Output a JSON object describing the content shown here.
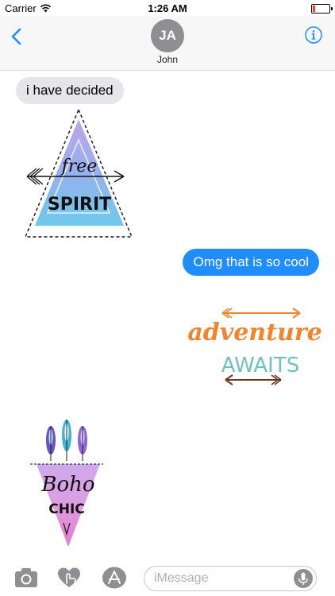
{
  "status_bar": {
    "carrier": "Carrier",
    "time": "1:26 AM"
  },
  "header": {
    "avatar_initials": "JA",
    "contact_name": "John"
  },
  "messages": [
    {
      "direction": "incoming",
      "text": "i have decided"
    },
    {
      "direction": "outgoing",
      "text": "Omg that is so cool"
    }
  ],
  "stickers": {
    "free_spirit": {
      "line1": "free",
      "line2": "SPIRIT"
    },
    "adventure": {
      "line1": "adventure",
      "line2": "AWAITS"
    },
    "boho": {
      "line1": "Boho",
      "line2": "CHIC"
    }
  },
  "input_bar": {
    "placeholder": "iMessage"
  },
  "colors": {
    "accent": "#1f8dfb",
    "incoming_bubble": "#e5e5ea",
    "adventure_orange": "#f0852d",
    "awaits_teal": "#6fc2bf"
  },
  "icons": [
    "wifi-icon",
    "battery-icon",
    "back-chevron-icon",
    "info-icon",
    "camera-icon",
    "digital-touch-icon",
    "app-store-icon",
    "microphone-icon"
  ]
}
